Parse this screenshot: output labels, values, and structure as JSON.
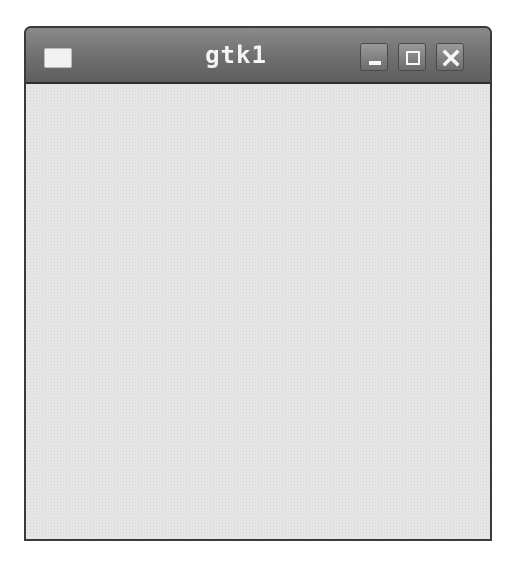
{
  "window": {
    "title": "gtk1",
    "buttons": [
      {
        "icon": "minimize-icon"
      },
      {
        "icon": "maximize-icon"
      },
      {
        "icon": "close-icon"
      }
    ]
  },
  "colors": {
    "titlebar": "#6f6f6f",
    "title_text": "#f4f4f4",
    "client_area": "#e8e8e8"
  }
}
